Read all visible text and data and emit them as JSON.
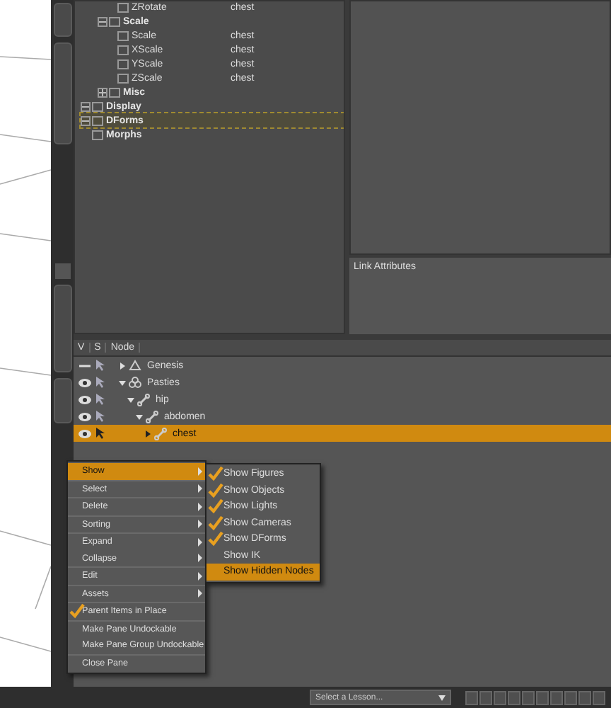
{
  "property_tree": {
    "cut_children": [
      {
        "children": [
          {
            "label": "ZRotate",
            "value": "chest"
          }
        ]
      },
      {
        "label": "Scale",
        "expanded": true,
        "children": [
          {
            "label": "Scale",
            "value": "chest"
          },
          {
            "label": "XScale",
            "value": "chest"
          },
          {
            "label": "YScale",
            "value": "chest"
          },
          {
            "label": "ZScale",
            "value": "chest"
          }
        ]
      },
      {
        "label": "Misc",
        "expanded": false
      }
    ],
    "nodes": [
      {
        "label": "Display",
        "expanded": true,
        "selected": false
      },
      {
        "label": "DForms",
        "expanded": true,
        "selected": true
      },
      {
        "label": "Morphs",
        "selected": false
      }
    ]
  },
  "link_attributes": {
    "title": "Link Attributes"
  },
  "scene": {
    "columns": [
      "V",
      "S",
      "Node"
    ],
    "nodes": [
      {
        "label": "Genesis",
        "kind": "figure",
        "visible": false,
        "expanded": false,
        "selected": false
      },
      {
        "label": "Pasties",
        "kind": "group",
        "visible": true,
        "expanded": true,
        "selected": false,
        "children": [
          {
            "label": "hip",
            "kind": "bone",
            "visible": true,
            "expanded": true,
            "selected": false,
            "children": [
              {
                "label": "abdomen",
                "kind": "bone",
                "visible": true,
                "expanded": true,
                "selected": false,
                "children": [
                  {
                    "label": "chest",
                    "kind": "bone",
                    "visible": true,
                    "expanded": false,
                    "selected": true
                  }
                ]
              }
            ]
          }
        ]
      }
    ]
  },
  "context_menu": {
    "sections": [
      [
        {
          "label": "Show",
          "kind": "submenu",
          "selected": true
        }
      ],
      [
        {
          "label": "Select",
          "kind": "submenu",
          "selected": false
        }
      ],
      [
        {
          "label": "Delete",
          "kind": "submenu",
          "selected": false
        }
      ],
      [
        {
          "label": "Sorting",
          "kind": "submenu",
          "selected": false
        }
      ],
      [
        {
          "label": "Expand",
          "kind": "submenu",
          "selected": false
        },
        {
          "label": "Collapse",
          "kind": "submenu",
          "selected": false
        }
      ],
      [
        {
          "label": "Edit",
          "kind": "submenu",
          "selected": false
        }
      ],
      [
        {
          "label": "Assets",
          "kind": "submenu",
          "selected": false
        }
      ],
      [
        {
          "label": "Parent Items in Place",
          "kind": "check",
          "checked": true,
          "selected": false
        }
      ],
      [
        {
          "label": "Make Pane Undockable",
          "kind": "action",
          "selected": false
        },
        {
          "label": "Make Pane Group Undockable",
          "kind": "action",
          "selected": false
        }
      ],
      [
        {
          "label": "Close Pane",
          "kind": "action",
          "selected": false
        }
      ]
    ]
  },
  "show_submenu": [
    {
      "label": "Show Figures",
      "checked": true,
      "selected": false
    },
    {
      "label": "Show Objects",
      "checked": true,
      "selected": false
    },
    {
      "label": "Show Lights",
      "checked": true,
      "selected": false
    },
    {
      "label": "Show Cameras",
      "checked": true,
      "selected": false
    },
    {
      "label": "Show DForms",
      "checked": true,
      "selected": false
    },
    {
      "label": "Show IK",
      "checked": false,
      "selected": false
    },
    {
      "label": "Show Hidden Nodes",
      "checked": false,
      "selected": true
    }
  ],
  "status_bar": {
    "lesson": {
      "placeholder": "Select a Lesson..."
    }
  }
}
